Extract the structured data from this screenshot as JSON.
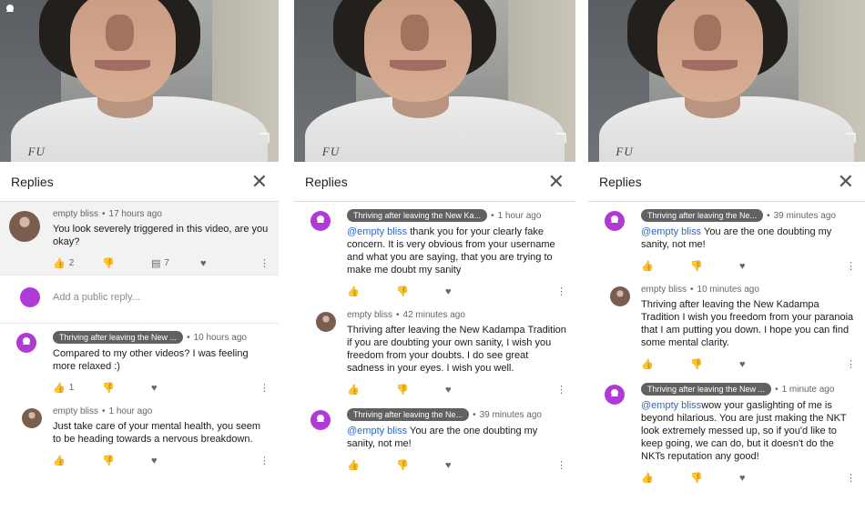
{
  "panels": [
    {
      "replies_title": "Replies",
      "hood_text": "FU",
      "comments": [
        {
          "author": "empty bliss",
          "time": "17 hours ago",
          "text": "You look severely triggered in this video, are you okay?",
          "likes": "2",
          "replies": "7"
        },
        {
          "author": "Thriving after leaving the New ...",
          "time": "10 hours ago",
          "text": "Compared to my other videos? I was feeling more relaxed :)",
          "likes": "1"
        },
        {
          "author": "empty bliss",
          "time": "1 hour ago",
          "text": "Just take care of your mental health, you seem to be heading towards a nervous breakdown."
        }
      ],
      "reply_placeholder": "Add a public reply..."
    },
    {
      "replies_title": "Replies",
      "hood_text": "FU",
      "comments": [
        {
          "author": "Thriving after leaving the New Ka...",
          "time": "1 hour ago",
          "mention": "@empty bliss",
          "text": " thank you for your clearly fake concern. It is very obvious from your username and what you are saying, that you are trying to make me doubt my sanity"
        },
        {
          "author": "empty bliss",
          "time": "42 minutes ago",
          "text": "Thriving after leaving the New Kadampa Tradition if you are doubting your own sanity, I wish you freedom from your doubts. I do see great sadness in your eyes. I wish you well."
        },
        {
          "author": "Thriving after leaving the Ne...",
          "time": "39 minutes ago",
          "mention": "@empty bliss",
          "text": " You are the one doubting my sanity, not me!"
        }
      ]
    },
    {
      "replies_title": "Replies",
      "hood_text": "FU",
      "comments": [
        {
          "author": "Thriving after leaving the Ne...",
          "time": "39 minutes ago",
          "mention": "@empty bliss",
          "text": " You are the one doubting my sanity, not me!"
        },
        {
          "author": "empty bliss",
          "time": "10 minutes ago",
          "text": "Thriving after leaving the New Kadampa Tradition I wish you freedom from your paranoia that I am putting you down. I hope you can find some mental clarity."
        },
        {
          "author": "Thriving after leaving the New ...",
          "time": "1 minute ago",
          "mention": "@empty bliss",
          "text": "wow your gaslighting of me is beyond hilarious. You are just making the NKT look extremely messed up, so if you'd like to keep going, we can do, but it doesn't do the NKTs reputation any good!"
        }
      ]
    }
  ],
  "icons": {
    "like": "thumbs-up-icon",
    "dislike": "thumbs-down-icon",
    "reply": "reply-icon",
    "heart": "heart-icon",
    "more": "more-vert-icon",
    "close": "close-icon"
  }
}
